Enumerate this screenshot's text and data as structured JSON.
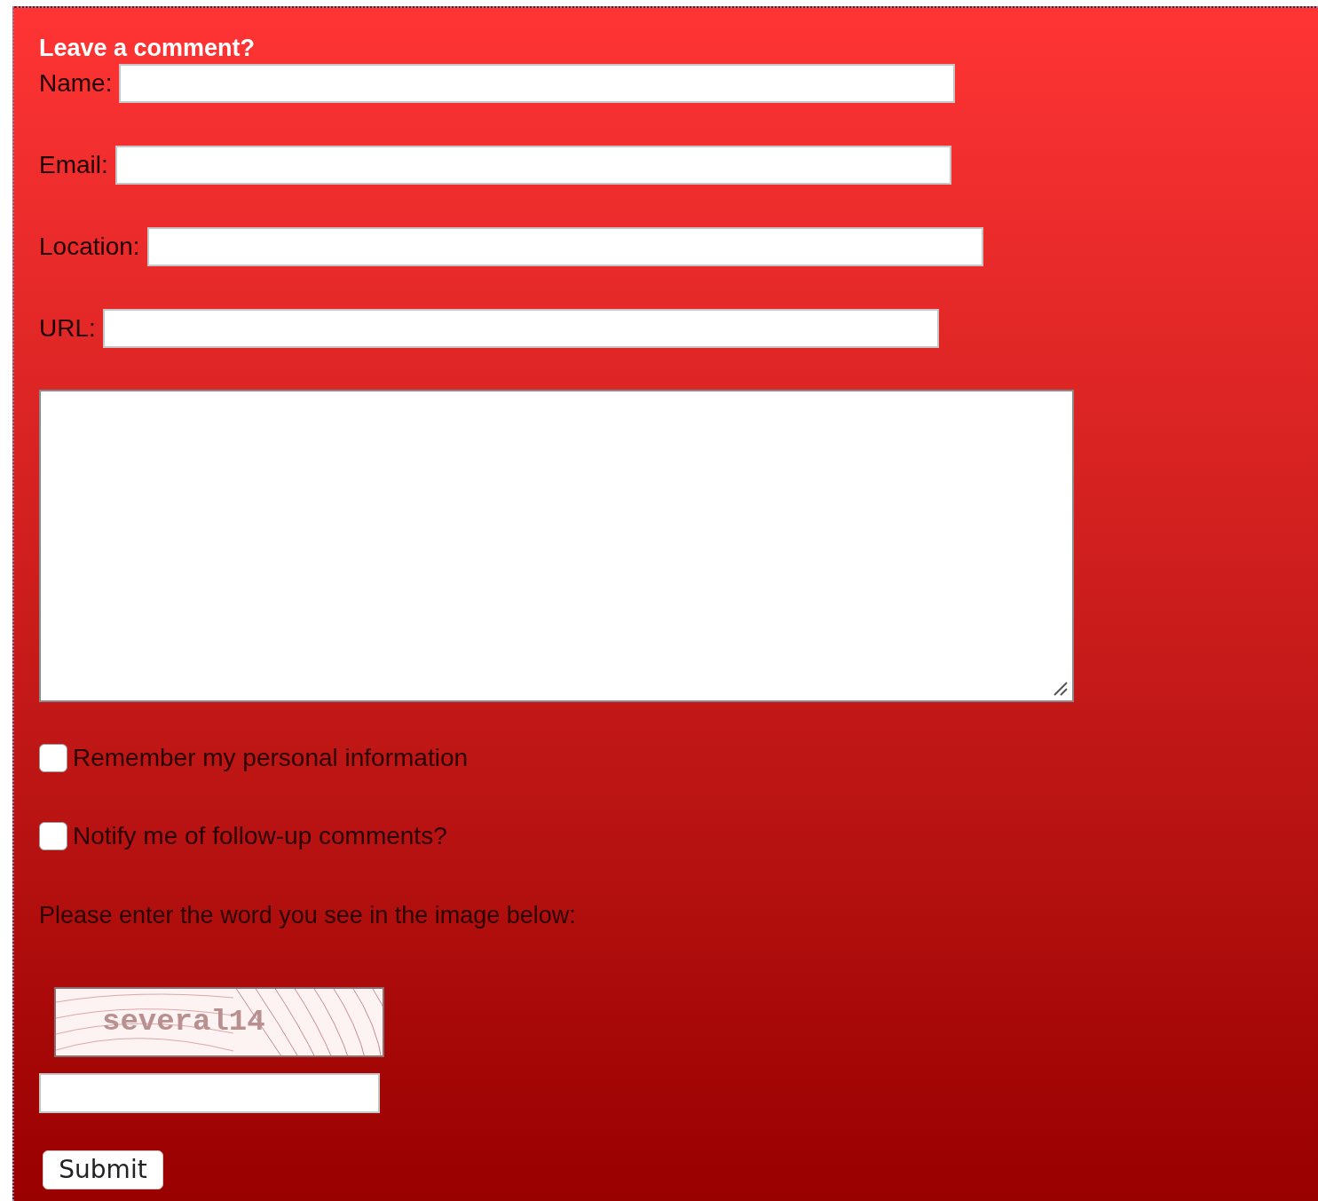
{
  "title": "Leave a comment?",
  "fields": [
    {
      "label": "Name:"
    },
    {
      "label": "Email:"
    },
    {
      "label": "Location:"
    },
    {
      "label": "URL:"
    }
  ],
  "options": [
    {
      "label": "Remember my personal information",
      "checked": false
    },
    {
      "label": "Notify me of follow-up comments?",
      "checked": false
    }
  ],
  "captcha": {
    "prompt": "Please enter the word you see in the image below:",
    "word": "several14"
  },
  "submit": "Submit"
}
